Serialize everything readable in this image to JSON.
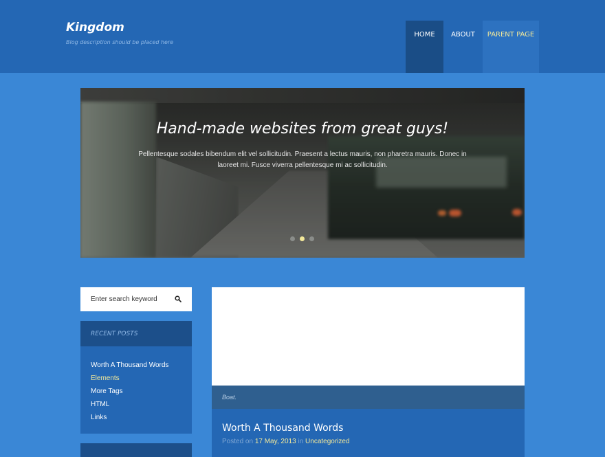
{
  "header": {
    "site_title": "Kingdom",
    "site_description": "Blog description should be placed here",
    "nav": [
      "HOME",
      "ABOUT",
      "PARENT PAGE"
    ]
  },
  "slider": {
    "title": "Hand-made websites from great guys!",
    "text": "Pellentesque sodales bibendum elit vel sollicitudin. Praesent a lectus mauris, non pharetra mauris. Donec in laoreet mi. Fusce viverra pellentesque mi ac sollicitudin.",
    "active_dot": 2,
    "dot_count": 3
  },
  "search": {
    "placeholder": "Enter search keyword"
  },
  "recent_posts": {
    "heading": "RECENT POSTS",
    "items": [
      "Worth A Thousand Words",
      "Elements",
      "More Tags",
      "HTML",
      "Links"
    ]
  },
  "post": {
    "caption": "Boat.",
    "title": "Worth A Thousand Words",
    "meta_prefix": "Posted on",
    "date": "17 May, 2013",
    "meta_in": "in",
    "category": "Uncategorized"
  },
  "colors": {
    "background": "#3a87d6",
    "header": "#2467b4",
    "nav_active": "#1a4d86",
    "accent": "#f2e89a"
  }
}
